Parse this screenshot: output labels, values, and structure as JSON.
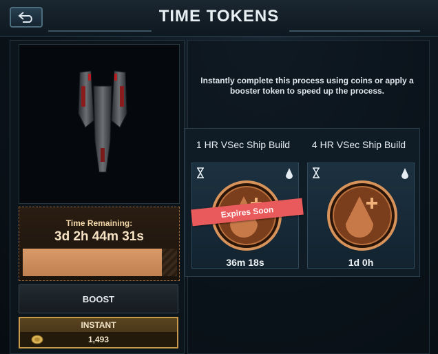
{
  "header": {
    "title": "TIME TOKENS",
    "back_icon": "back-arrow-icon"
  },
  "left": {
    "ship_icon": "spaceship-icon",
    "time_remaining_label": "Time Remaining:",
    "time_remaining_value": "3d 2h 44m 31s",
    "progress_fraction": 0.9,
    "boost_label": "BOOST",
    "instant_label": "INSTANT",
    "instant_cost": "1,493",
    "coin_icon": "coin-icon"
  },
  "right": {
    "info_text": "Instantly complete this process using coins or apply a booster token to speed up the process.",
    "tokens": [
      {
        "title": "1 HR VSec Ship Build",
        "time": "36m 18s",
        "badge": "Expires Soon"
      },
      {
        "title": "4 HR VSec Ship Build",
        "time": "1d 0h"
      }
    ]
  },
  "colors": {
    "accent_orange": "#c08050",
    "gold_border": "#c69a4a",
    "ribbon_red": "#e85a5c"
  }
}
